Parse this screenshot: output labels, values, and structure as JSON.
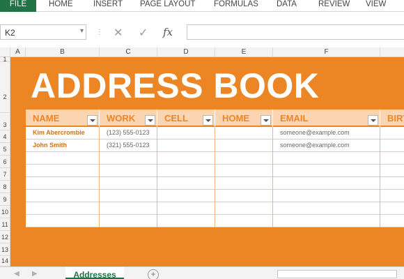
{
  "ribbon": {
    "tabs": [
      "FILE",
      "HOME",
      "INSERT",
      "PAGE LAYOUT",
      "FORMULAS",
      "DATA",
      "REVIEW",
      "VIEW"
    ]
  },
  "formula_bar": {
    "name_box": "K2",
    "cancel_glyph": "✕",
    "enter_glyph": "✓",
    "function_label": "fx",
    "formula_value": ""
  },
  "grid": {
    "columns": [
      "A",
      "B",
      "C",
      "D",
      "E",
      "F"
    ],
    "rows": [
      "1",
      "2",
      "3",
      "4",
      "5",
      "6",
      "7",
      "8",
      "9",
      "10",
      "11",
      "12",
      "13",
      "14"
    ]
  },
  "sheet": {
    "title": "ADDRESS BOOK",
    "accent_color": "#ec8523",
    "headers": [
      "NAME",
      "WORK",
      "CELL",
      "HOME",
      "EMAIL",
      "BIRT"
    ],
    "rows": [
      [
        "Kim Abercrombie",
        "(123) 555-0123",
        "",
        "",
        "someone@example.com",
        ""
      ],
      [
        "John Smith",
        "(321) 555-0123",
        "",
        "",
        "someone@example.com",
        ""
      ],
      [
        "",
        "",
        "",
        "",
        "",
        ""
      ],
      [
        "",
        "",
        "",
        "",
        "",
        ""
      ],
      [
        "",
        "",
        "",
        "",
        "",
        ""
      ],
      [
        "",
        "",
        "",
        "",
        "",
        ""
      ],
      [
        "",
        "",
        "",
        "",
        "",
        ""
      ],
      [
        "",
        "",
        "",
        "",
        "",
        ""
      ]
    ]
  },
  "tabs_bar": {
    "active_sheet": "Addresses",
    "add_sheet_glyph": "+",
    "nav_prev": "◀",
    "nav_next": "▶"
  }
}
